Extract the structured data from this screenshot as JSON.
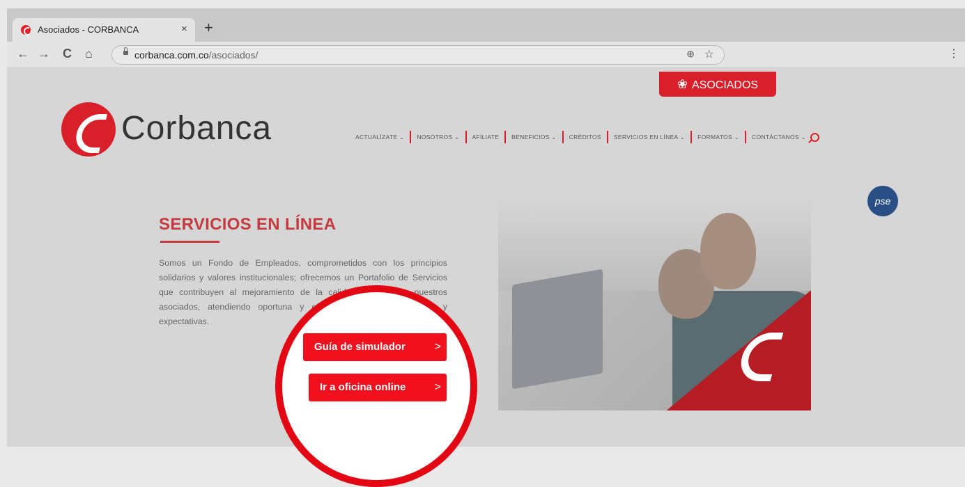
{
  "browser": {
    "tab_title": "Asociados - CORBANCA",
    "tab_close": "×",
    "new_tab": "+",
    "nav": {
      "back": "←",
      "forward": "→",
      "reload": "C",
      "home": "⌂"
    },
    "url_domain": "corbanca.com.co",
    "url_path": "/asociados/",
    "zoom_glyph": "⊕",
    "star_glyph": "☆",
    "menu_glyph": "⋮"
  },
  "site": {
    "asociados_tab": "ASOCIADOS",
    "asociados_icon": "❀",
    "logo_text": "Corbanca",
    "nav": [
      "ACTUALÍZATE ⌄",
      "NOSOTROS ⌄",
      "AFÍLIATE",
      "BENEFICIOS ⌄",
      "CRÉDITOS",
      "SERVICIOS EN LÍNEA ⌄",
      "FORMATOS ⌄",
      "CONTÁCTANOS ⌄"
    ],
    "pse_label": "pse",
    "heading": "SERVICIOS EN LÍNEA",
    "body": "Somos un Fondo de Empleados, comprometidos con los principios solidarios y valores institucionales; ofrecemos un Portafolio de Servicios que contribuyen al mejoramiento de la calidad de vida de nuestros asociados, atendiendo oportuna y eficazmente sus necesidades y expectativas.",
    "buttons": {
      "simulator": "Guía de simulador",
      "office": "Ir a oficina online",
      "chevron": ">"
    },
    "colors": {
      "brand_red": "#d9202a",
      "highlight_red": "#e30613",
      "heading": "#c53a3f"
    }
  }
}
